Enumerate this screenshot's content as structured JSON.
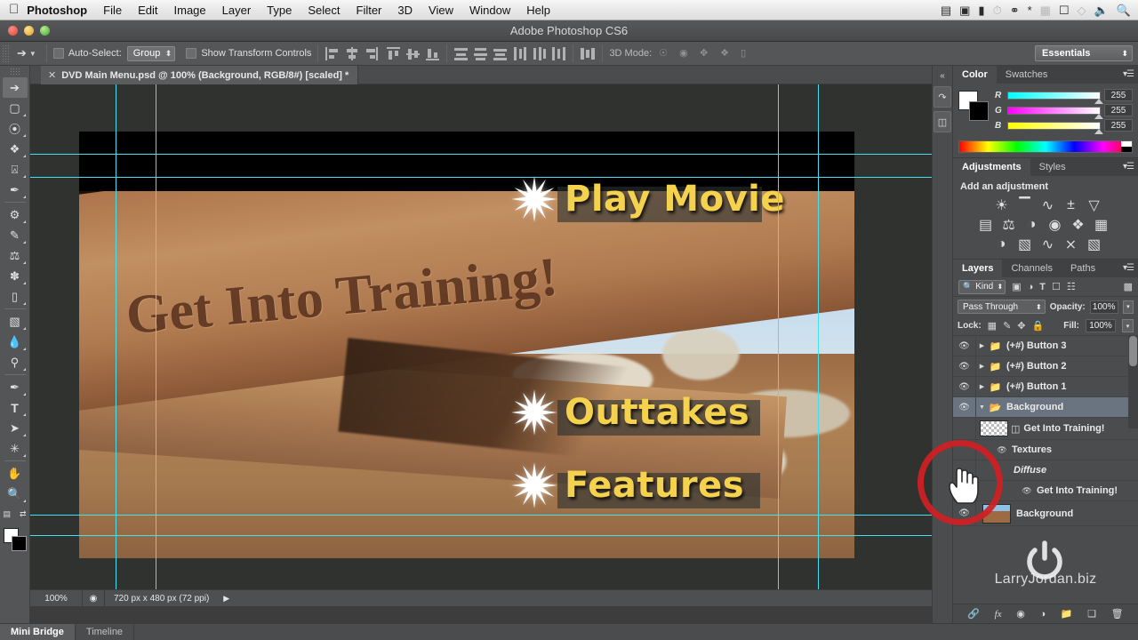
{
  "macmenu": {
    "apple": "apple-logo",
    "items": [
      "Photoshop",
      "File",
      "Edit",
      "Image",
      "Layer",
      "Type",
      "Select",
      "Filter",
      "3D",
      "View",
      "Window",
      "Help"
    ],
    "status_icons": [
      "airplay-icon",
      "video-camera-icon",
      "battery-icon",
      "time-machine-icon",
      "spotlight-binoculars-icon",
      "bluetooth-icon",
      "grid-icon",
      "display-icon",
      "wifi-icon",
      "volume-icon",
      "search-icon"
    ]
  },
  "window": {
    "title": "Adobe Photoshop CS6",
    "traffic": [
      "close",
      "minimize",
      "zoom"
    ]
  },
  "options_bar": {
    "tool": "move-tool",
    "auto_select_label": "Auto-Select:",
    "auto_select_value": "Group",
    "show_transform_label": "Show Transform Controls",
    "mode3d_label": "3D Mode:",
    "workspace": "Essentials"
  },
  "document_tab": {
    "close": "×",
    "title": "DVD Main Menu.psd @ 100% (Background, RGB/8#) [scaled] *"
  },
  "toolbar": {
    "tools": [
      "move-tool",
      "marquee-tool",
      "lasso-tool",
      "quick-selection-tool",
      "crop-tool",
      "eyedropper-tool",
      "healing-brush-tool",
      "brush-tool",
      "clone-stamp-tool",
      "history-brush-tool",
      "eraser-tool",
      "gradient-tool",
      "blur-tool",
      "dodge-tool",
      "pen-tool",
      "type-tool",
      "path-selection-tool",
      "shape-tool",
      "hand-tool",
      "zoom-tool"
    ],
    "foreground_color": "#ffffff",
    "background_color": "#000000"
  },
  "canvas": {
    "engraved_text": "Get Into Training!",
    "buttons": [
      {
        "label": "Play Movie",
        "icon": "starburst-icon"
      },
      {
        "label": "Outtakes",
        "icon": "starburst-icon"
      },
      {
        "label": "Features",
        "icon": "starburst-icon"
      }
    ],
    "guide_color": "#45e0f0",
    "text_color": "#f5d24e"
  },
  "status_bar": {
    "zoom": "100%",
    "doc_icon": "document-size-icon",
    "dimensions": "720 px x 480 px (72 ppi)",
    "expand": "▶"
  },
  "bottom_tabs": [
    {
      "label": "Mini Bridge",
      "active": true
    },
    {
      "label": "Timeline",
      "active": false
    }
  ],
  "color_panel": {
    "tabs": [
      {
        "label": "Color",
        "active": true
      },
      {
        "label": "Swatches",
        "active": false
      }
    ],
    "menu": "panel-menu-icon",
    "channels": [
      {
        "name": "R",
        "value": "255"
      },
      {
        "name": "G",
        "value": "255"
      },
      {
        "name": "B",
        "value": "255"
      }
    ],
    "foreground": "#ffffff",
    "background": "#000000"
  },
  "adjustments_panel": {
    "tabs": [
      {
        "label": "Adjustments",
        "active": true
      },
      {
        "label": "Styles",
        "active": false
      }
    ],
    "menu": "panel-menu-icon",
    "heading": "Add an adjustment",
    "row1": [
      "brightness-contrast-icon",
      "levels-icon",
      "curves-icon",
      "exposure-icon",
      "vibrance-icon"
    ],
    "row2": [
      "hue-saturation-icon",
      "color-balance-icon",
      "black-white-icon",
      "photo-filter-icon",
      "channel-mixer-icon",
      "color-lookup-icon"
    ],
    "row3": [
      "invert-icon",
      "posterize-icon",
      "threshold-icon",
      "selective-color-icon",
      "gradient-map-icon"
    ]
  },
  "layers_panel": {
    "tabs": [
      {
        "label": "Layers",
        "active": true
      },
      {
        "label": "Channels",
        "active": false
      },
      {
        "label": "Paths",
        "active": false
      }
    ],
    "menu": "panel-menu-icon",
    "filter_label": "Kind",
    "filter_icons": [
      "pixel-layer-filter-icon",
      "adjustment-layer-filter-icon",
      "type-layer-filter-icon",
      "shape-layer-filter-icon",
      "smart-object-filter-icon"
    ],
    "blend_mode": "Pass Through",
    "opacity_label": "Opacity:",
    "opacity_value": "100%",
    "lock_label": "Lock:",
    "lock_icons": [
      "lock-transparent-pixels-icon",
      "lock-image-pixels-icon",
      "lock-position-icon",
      "lock-all-icon"
    ],
    "fill_label": "Fill:",
    "fill_value": "100%",
    "rows": [
      {
        "name": "(+#) Button 3",
        "type": "group",
        "visible": true,
        "expanded": false,
        "selected": false
      },
      {
        "name": "(+#) Button 2",
        "type": "group",
        "visible": true,
        "expanded": false,
        "selected": false
      },
      {
        "name": "(+#) Button 1",
        "type": "group",
        "visible": true,
        "expanded": false,
        "selected": false
      },
      {
        "name": "Background",
        "type": "group",
        "visible": true,
        "expanded": true,
        "selected": true
      },
      {
        "name": "Get Into Training!",
        "type": "3d-layer",
        "visible": true,
        "selected": false
      },
      {
        "name": "Textures",
        "type": "sub-entry",
        "visible": true,
        "selected": false
      },
      {
        "name": "Diffuse",
        "type": "sub-label",
        "visible": false,
        "selected": false
      },
      {
        "name": "Get Into Training!",
        "type": "sub-entry-deep",
        "visible": true,
        "selected": false
      },
      {
        "name": "Background",
        "type": "image",
        "visible": true,
        "selected": false
      }
    ],
    "watermark": "LarryJordan.biz",
    "bottom_icons": [
      "link-layers-icon",
      "layer-style-fx-icon",
      "layer-mask-icon",
      "new-adjustment-layer-icon",
      "new-group-icon",
      "new-layer-icon",
      "delete-layer-icon"
    ]
  },
  "dock_rail": {
    "collapse": "double-arrow-collapse-icon",
    "buttons": [
      "history-panel-icon",
      "mini-bridge-panel-icon"
    ]
  },
  "annotations": {
    "highlight_circle_color": "#d11f24",
    "cursor": "pointing-hand-cursor",
    "power_glyph": "power-button-watermark"
  }
}
